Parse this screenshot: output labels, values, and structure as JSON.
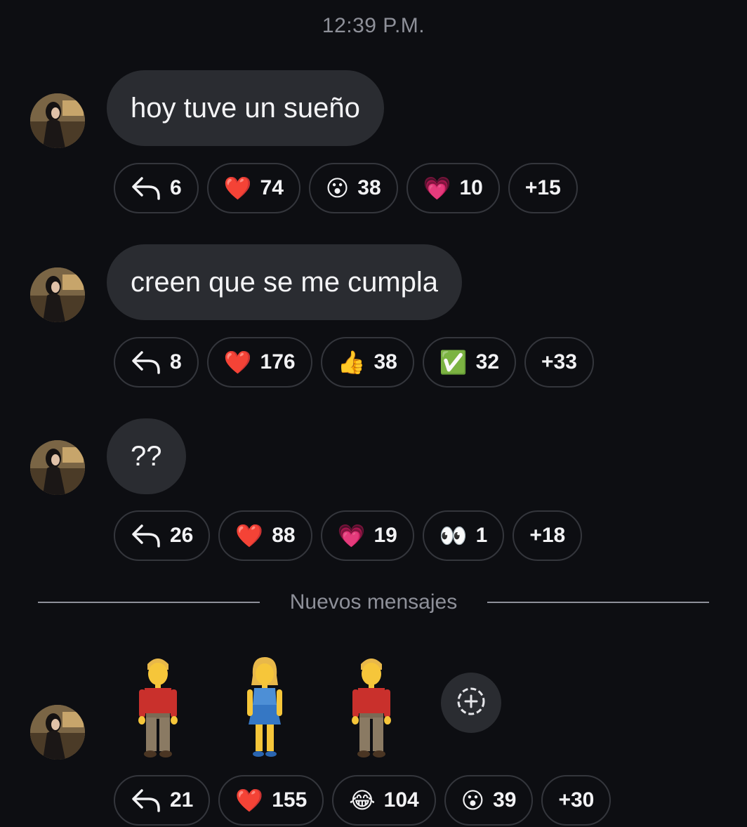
{
  "timestamp": "12:39 P.M.",
  "messages": [
    {
      "text": "hoy tuve un sueño",
      "reactions": [
        {
          "icon": "reply-icon",
          "count": "6"
        },
        {
          "icon": "❤️",
          "count": "74"
        },
        {
          "icon": "😮",
          "count": "38"
        },
        {
          "icon": "💗",
          "count": "10"
        },
        {
          "icon": "",
          "count": "+15"
        }
      ]
    },
    {
      "text": "creen que se me cumpla",
      "reactions": [
        {
          "icon": "reply-icon",
          "count": "8"
        },
        {
          "icon": "❤️",
          "count": "176"
        },
        {
          "icon": "👍",
          "count": "38"
        },
        {
          "icon": "✅",
          "count": "32"
        },
        {
          "icon": "",
          "count": "+33"
        }
      ]
    },
    {
      "text": "??",
      "reactions": [
        {
          "icon": "reply-icon",
          "count": "26"
        },
        {
          "icon": "❤️",
          "count": "88"
        },
        {
          "icon": "💗",
          "count": "19"
        },
        {
          "icon": "👀",
          "count": "1"
        },
        {
          "icon": "",
          "count": "+18"
        }
      ]
    }
  ],
  "divider_label": "Nuevos mensajes",
  "last_message": {
    "emojis": [
      "man-standing",
      "woman-standing",
      "man-standing"
    ],
    "reactions": [
      {
        "icon": "reply-icon",
        "count": "21"
      },
      {
        "icon": "❤️",
        "count": "155"
      },
      {
        "icon": "😂",
        "count": "104"
      },
      {
        "icon": "😮",
        "count": "39"
      },
      {
        "icon": "",
        "count": "+30"
      }
    ]
  },
  "colors": {
    "background": "#0d0e12",
    "bubble": "#2a2c31",
    "pill_border": "#34363c",
    "muted_text": "#8e9099"
  }
}
